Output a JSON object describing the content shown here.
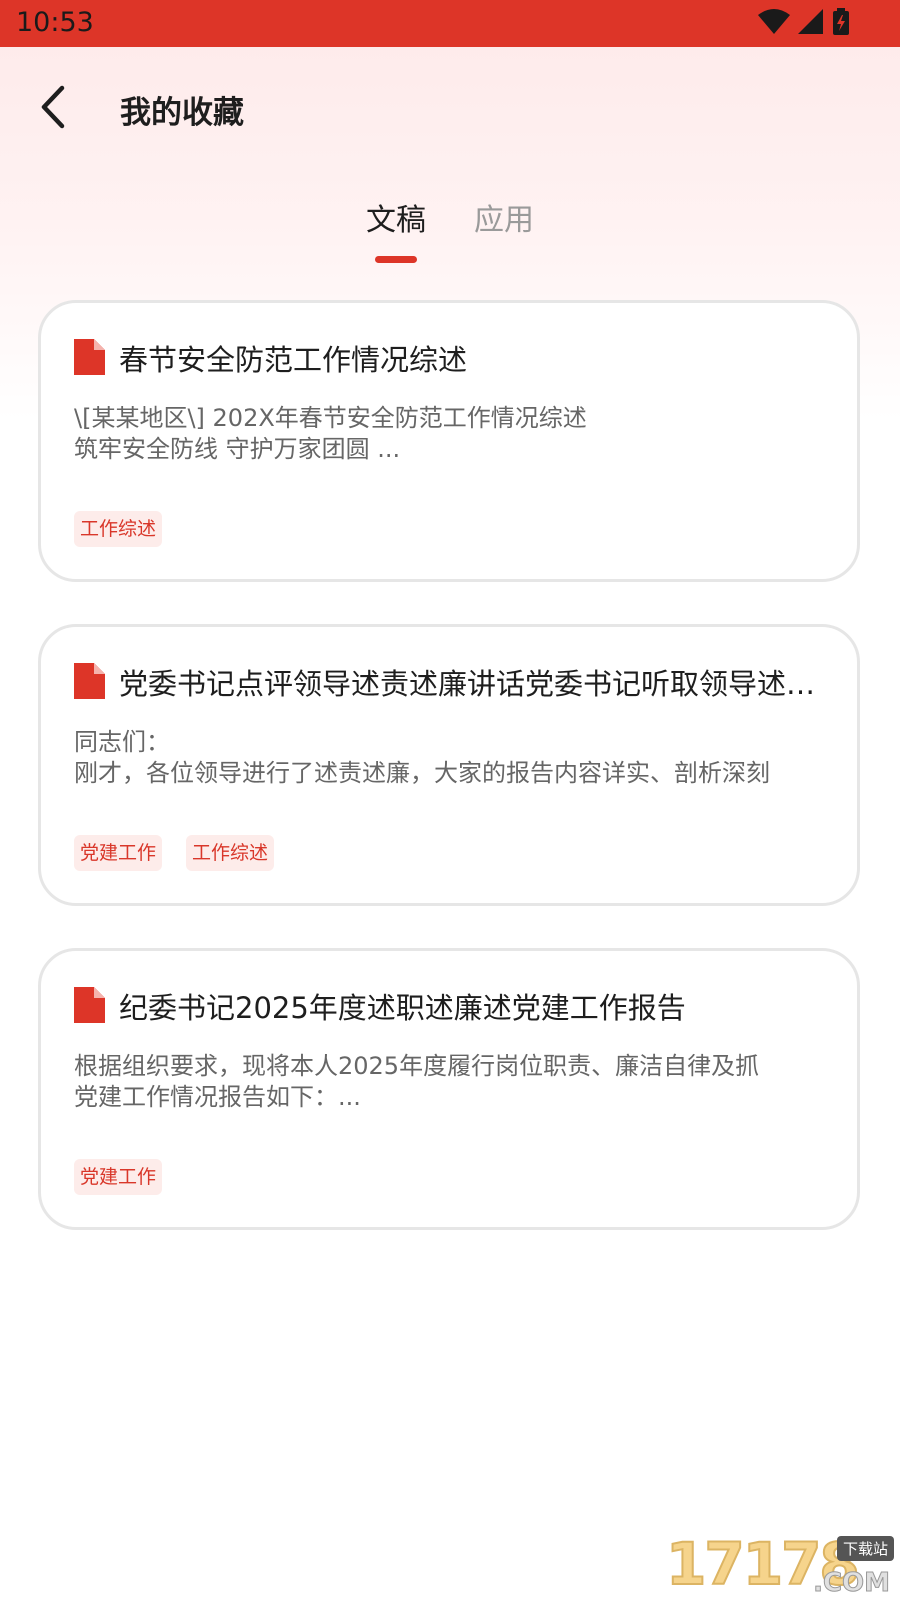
{
  "status_bar": {
    "time": "10:53"
  },
  "header": {
    "title": "我的收藏"
  },
  "tabs": [
    {
      "label": "文稿",
      "active": true
    },
    {
      "label": "应用",
      "active": false
    }
  ],
  "cards": [
    {
      "title": "春节安全防范工作情况综述",
      "excerpt": [
        "\\[某某地区\\] 202X年春节安全防范工作情况综述",
        "筑牢安全防线 守护万家团圆  ..."
      ],
      "tags": [
        "工作综述"
      ]
    },
    {
      "title": "党委书记点评领导述责述廉讲话党委书记听取领导述职述廉",
      "excerpt": [
        "同志们：",
        "刚才，各位领导进行了述责述廉，大家的报告内容详实、剖析深刻"
      ],
      "tags": [
        "党建工作",
        "工作综述"
      ]
    },
    {
      "title": "纪委书记2025年度述职述廉述党建工作报告",
      "excerpt": [
        "根据组织要求，现将本人2025年度履行岗位职责、廉洁自律及抓",
        "党建工作情况报告如下：..."
      ],
      "tags": [
        "党建工作"
      ]
    }
  ],
  "watermark": {
    "number": "17178",
    "badge": "下载站",
    "suffix": ".COM"
  },
  "colors": {
    "accent": "#dd3528",
    "tag_bg": "#fdecea",
    "tag_text": "#d9372a"
  },
  "icons": {
    "back": "chevron-left-icon",
    "document": "document-icon",
    "wifi": "wifi-icon",
    "signal": "signal-icon",
    "battery": "battery-icon"
  }
}
